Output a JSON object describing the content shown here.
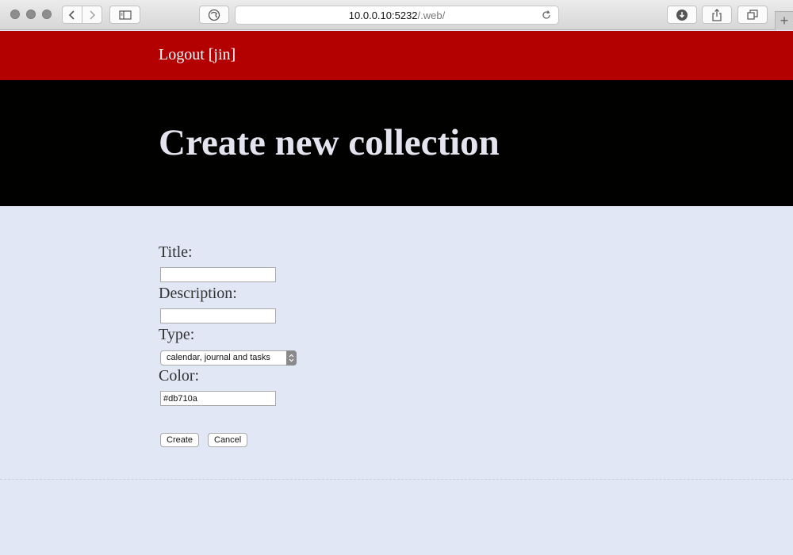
{
  "browser": {
    "url_host": "10.0.0.10:5232",
    "url_path": "/.web/",
    "new_tab_label": "+"
  },
  "header": {
    "logout_label": "Logout [jin]"
  },
  "hero": {
    "title": "Create new collection"
  },
  "form": {
    "title_label": "Title:",
    "title_value": "",
    "description_label": "Description:",
    "description_value": "",
    "type_label": "Type:",
    "type_selected": "calendar, journal and tasks",
    "color_label": "Color:",
    "color_value": "#db710a",
    "create_label": "Create",
    "cancel_label": "Cancel"
  },
  "colors": {
    "topbar": "#b30000",
    "hero": "#010200",
    "background": "#e2e7f5"
  }
}
